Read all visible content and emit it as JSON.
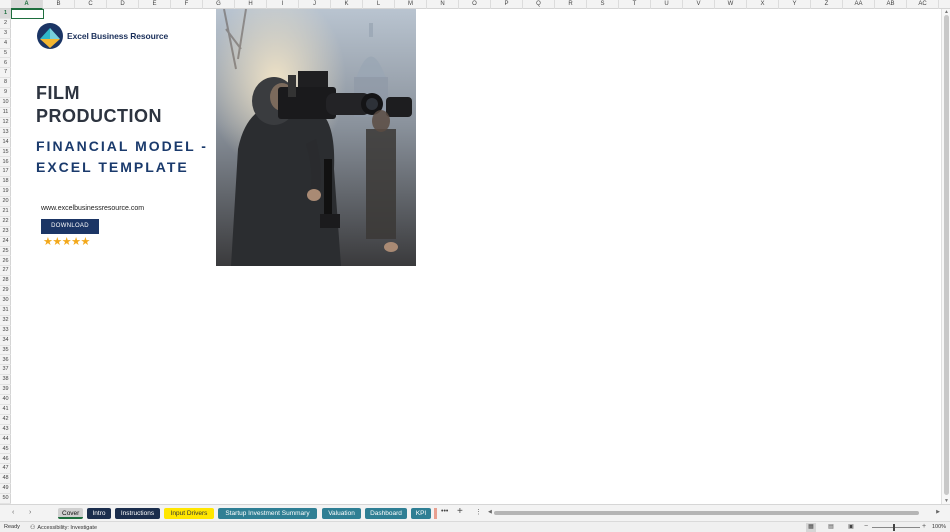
{
  "columns": [
    "A",
    "B",
    "C",
    "D",
    "E",
    "F",
    "G",
    "H",
    "I",
    "J",
    "K",
    "L",
    "M",
    "N",
    "O",
    "P",
    "Q",
    "R",
    "S",
    "T",
    "U",
    "V",
    "W",
    "X",
    "Y",
    "Z",
    "AA",
    "AB",
    "AC"
  ],
  "active_column": "A",
  "rows": [
    "1",
    "2",
    "3",
    "4",
    "5",
    "6",
    "7",
    "8",
    "9",
    "10",
    "11",
    "12",
    "13",
    "14",
    "15",
    "16",
    "17",
    "18",
    "19",
    "20",
    "21",
    "22",
    "23",
    "24",
    "25",
    "26",
    "27",
    "28",
    "29",
    "30",
    "31",
    "32",
    "33",
    "34",
    "35",
    "36",
    "37",
    "38",
    "39",
    "40",
    "41",
    "42",
    "43",
    "44",
    "45",
    "46",
    "47",
    "48",
    "49",
    "50"
  ],
  "active_row": "1",
  "cover": {
    "logo_text": "Excel Business Resource",
    "title_line1": "FILM",
    "title_line2": "PRODUCTION",
    "title_line3": "FINANCIAL MODEL -",
    "title_line4": "EXCEL TEMPLATE",
    "website": "www.excelbusinessresource.com",
    "download_label": "DOWNLOAD",
    "stars": "★★★★★",
    "rating": 5
  },
  "sheet_tabs": {
    "cover": "Cover",
    "intro": "Intro",
    "instructions": "Instructions",
    "input_drivers": "Input Drivers",
    "startup": "Startup Investment Summary",
    "valuation": "Valuation",
    "dashboard": "Dashboard",
    "kpi": "KPI",
    "more": "•••",
    "add": "+",
    "menu": "⋮",
    "prev": "‹",
    "next": "›"
  },
  "status_bar": {
    "ready": "Ready",
    "accessibility": "Accessibility: Investigate",
    "zoom_level": "100%"
  },
  "colors": {
    "brand_navy": "#1b3565",
    "title_dark": "#2d3440",
    "title_blue": "#1a3a6c",
    "star_gold": "#f3a81a",
    "tab_teal": "#2f7f94",
    "tab_navy": "#1b2e4d",
    "tab_yellow": "#ffe600"
  }
}
